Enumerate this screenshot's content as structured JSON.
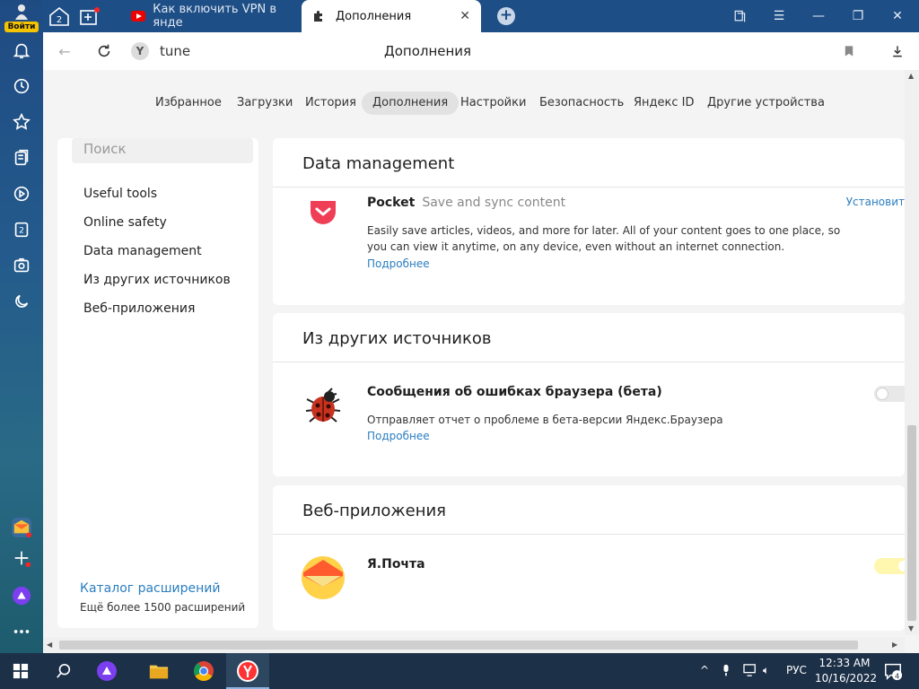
{
  "sidebar": {
    "login_label": "Войти",
    "tab_count": "2"
  },
  "tabs": {
    "badge_count": "2",
    "tab1_title": "Как включить VPN в янде",
    "tab2_title": "Дополнения"
  },
  "address": {
    "url": "tune",
    "page_title": "Дополнения"
  },
  "nav": {
    "items": [
      "Избранное",
      "Загрузки",
      "История",
      "Дополнения",
      "Настройки",
      "Безопасность",
      "Яндекс ID",
      "Другие устройства"
    ]
  },
  "left": {
    "search_placeholder": "Поиск",
    "items": [
      "Useful tools",
      "Online safety",
      "Data management",
      "Из других источников",
      "Веб-приложения"
    ],
    "catalog": "Каталог расширений",
    "catalog_sub": "Ещё более 1500 расширений"
  },
  "sections": {
    "data_management": {
      "title": "Data management",
      "ext": {
        "name": "Pocket",
        "tagline": "Save and sync content",
        "desc": "Easily save articles, videos, and more for later. All of your content goes to one place, so you can view it anytime, on any device, even without an internet connection.",
        "more": "Подробнее",
        "install": "Установит"
      }
    },
    "other_sources": {
      "title": "Из других источников",
      "ext": {
        "name": "Сообщения об ошибках браузера (бета)",
        "desc": "Отправляет отчет о проблеме в бета-версии Яндекс.Браузера",
        "more": "Подробнее",
        "enabled": false
      }
    },
    "web_apps": {
      "title": "Веб-приложения",
      "ext": {
        "name": "Я.Почта",
        "enabled": true
      }
    }
  },
  "taskbar": {
    "lang": "РУС",
    "time": "12:33 AM",
    "date": "10/16/2022",
    "notifications": "4"
  },
  "colors": {
    "accent_link": "#2a7ec1",
    "tabstrip": "#1e4e86",
    "taskbar": "#1c3048"
  }
}
